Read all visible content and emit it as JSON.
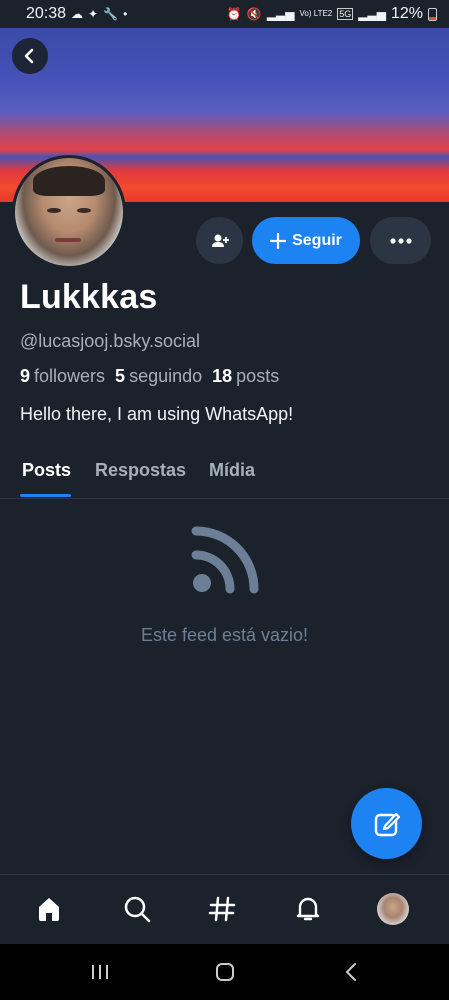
{
  "status_bar": {
    "time": "20:38",
    "battery": "12%",
    "network": "5G",
    "volte": "Vo) LTE2"
  },
  "profile": {
    "display_name": "Lukkkas",
    "handle": "@lucasjooj.bsky.social",
    "followers_count": "9",
    "followers_label": "followers",
    "following_count": "5",
    "following_label": "seguindo",
    "posts_count": "18",
    "posts_label": "posts",
    "bio": "Hello there, I am using WhatsApp!"
  },
  "actions": {
    "follow_label": "Seguir"
  },
  "tabs": [
    {
      "label": "Posts",
      "active": true
    },
    {
      "label": "Respostas",
      "active": false
    },
    {
      "label": "Mídia",
      "active": false
    }
  ],
  "feed": {
    "empty_message": "Este feed está vazio!"
  },
  "colors": {
    "background": "#1b222c",
    "accent": "#1d83f2",
    "muted_text": "#a6b0bd"
  },
  "icons": {
    "back": "chevron-left-icon",
    "add_user": "person-add-icon",
    "more": "ellipsis-icon",
    "empty_feed": "rss-icon",
    "compose": "edit-icon",
    "nav": [
      "home-icon",
      "search-icon",
      "hashtag-icon",
      "bell-icon",
      "avatar"
    ]
  }
}
